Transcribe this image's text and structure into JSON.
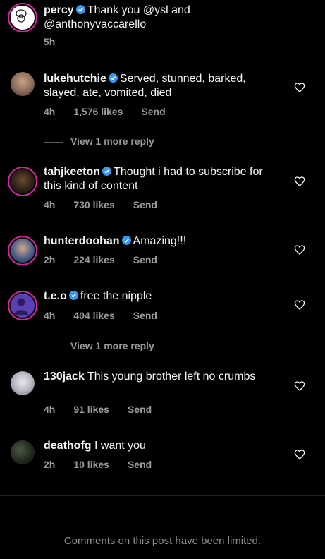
{
  "caption": {
    "username": "percy",
    "text": "Thank you @ysl and @anthonyvaccarello",
    "time": "5h"
  },
  "comments": [
    {
      "username": "lukehutchie",
      "verified": true,
      "text": "Served, stunned, barked, slayed, ate, vomited, died",
      "time": "4h",
      "likes": "1,576 likes",
      "send": "Send",
      "view_more": "View 1 more reply"
    },
    {
      "username": "tahjkeeton",
      "verified": true,
      "text": "Thought i had to subscribe for this kind of content",
      "time": "4h",
      "likes": "730 likes",
      "send": "Send"
    },
    {
      "username": "hunterdoohan",
      "verified": true,
      "text": "Amazing!!!",
      "time": "2h",
      "likes": "224 likes",
      "send": "Send"
    },
    {
      "username": "t.e.o",
      "verified": true,
      "text": "free the nipple",
      "time": "4h",
      "likes": "404 likes",
      "send": "Send",
      "view_more": "View 1 more reply"
    },
    {
      "username": "130jack",
      "verified": false,
      "text": "This young brother left no crumbs",
      "time": "4h",
      "likes": "91 likes",
      "send": "Send"
    },
    {
      "username": "deathofg",
      "verified": false,
      "text": "I want you",
      "time": "2h",
      "likes": "10 likes",
      "send": "Send"
    }
  ],
  "footer": "Comments on this post have been limited.",
  "colors": {
    "verified": "#3897f0",
    "story_ring": "#d6249f",
    "meta": "#9a9a9a"
  }
}
